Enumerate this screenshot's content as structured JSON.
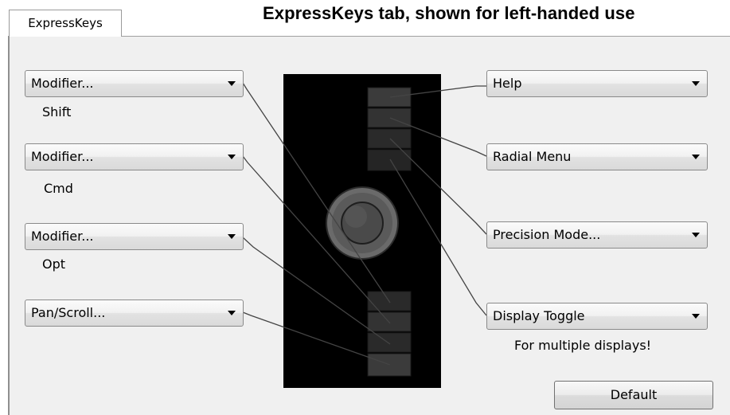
{
  "caption": "ExpressKeys tab, shown for left-handed use",
  "tab_label": "ExpressKeys",
  "left_keys": [
    {
      "label": "Modifier...",
      "sublabel": "Shift"
    },
    {
      "label": "Modifier...",
      "sublabel": "Cmd"
    },
    {
      "label": "Modifier...",
      "sublabel": "Opt"
    },
    {
      "label": "Pan/Scroll...",
      "sublabel": ""
    }
  ],
  "right_keys": [
    {
      "label": "Help"
    },
    {
      "label": "Radial Menu"
    },
    {
      "label": "Precision Mode..."
    },
    {
      "label": "Display Toggle"
    }
  ],
  "display_toggle_note": "For multiple displays!",
  "default_button": "Default",
  "icons": {
    "dropdown": "chevron-down-icon",
    "touch_ring": "touch-ring-icon"
  },
  "colors": {
    "tablet": "#000000",
    "panel": "#f0f0f0",
    "callout_line": "#444444"
  }
}
